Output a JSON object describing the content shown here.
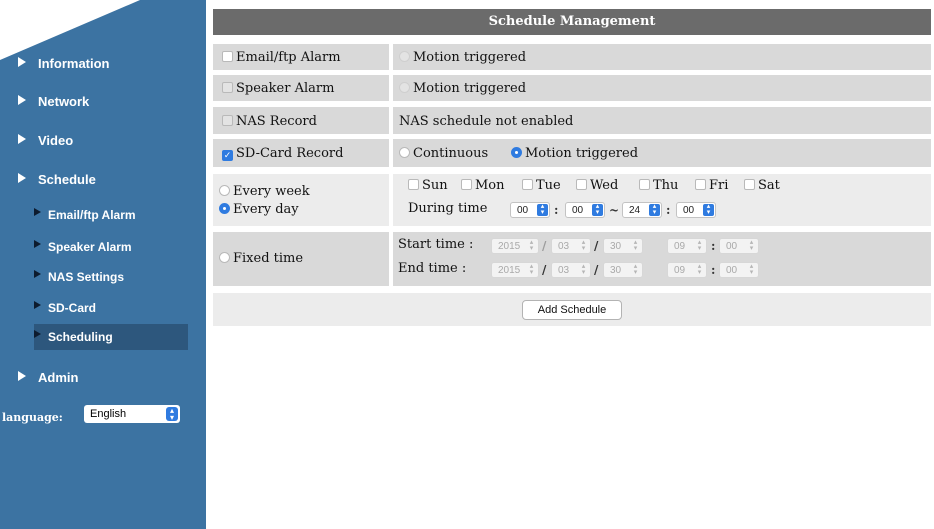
{
  "sidebar": {
    "menu": {
      "information": "Information",
      "network": "Network",
      "video": "Video",
      "schedule": "Schedule",
      "admin": "Admin"
    },
    "submenu": {
      "email_ftp_alarm": "Email/ftp Alarm",
      "speaker_alarm": "Speaker Alarm",
      "nas_settings": "NAS Settings",
      "sd_card": "SD-Card",
      "scheduling": "Scheduling"
    },
    "active_item": "Scheduling",
    "language_label": "language:",
    "language_value": "English"
  },
  "panel": {
    "title": "Schedule Management",
    "email_ftp_alarm": {
      "label": "Email/ftp Alarm",
      "checked": false,
      "option": "Motion triggered"
    },
    "speaker_alarm": {
      "label": "Speaker Alarm",
      "checked": false,
      "option": "Motion triggered"
    },
    "nas_record": {
      "label": "NAS Record",
      "checked": false,
      "status": "NAS schedule not enabled"
    },
    "sd_card_record": {
      "label": "SD-Card Record",
      "checked": true,
      "option_continuous": "Continuous",
      "option_motion": "Motion triggered",
      "selected": "Motion triggered"
    },
    "repeat": {
      "every_week": "Every week",
      "every_day": "Every day",
      "selected": "Every day",
      "days": [
        "Sun",
        "Mon",
        "Tue",
        "Wed",
        "Thu",
        "Fri",
        "Sat"
      ],
      "during_label": "During time",
      "during": {
        "start_hour": "00",
        "start_min": "00",
        "tilde": "~",
        "end_hour": "24",
        "end_min": "00",
        "colon": ":"
      }
    },
    "fixed": {
      "label": "Fixed time",
      "start_label": "Start time :",
      "end_label": "End time :",
      "start": {
        "year": "2015",
        "month": "03",
        "day": "30",
        "hour": "09",
        "minute": "00"
      },
      "end": {
        "year": "2015",
        "month": "03",
        "day": "30",
        "hour": "09",
        "minute": "00"
      },
      "slash": "/",
      "colon": ":"
    },
    "add_button": "Add Schedule"
  },
  "colors": {
    "sidebar": "#3c73a2",
    "active_item": "#2d577d",
    "header": "#6b6b6b",
    "row_dark": "#d9d9d9",
    "row_light": "#ececec",
    "accent": "#2f7be0"
  }
}
